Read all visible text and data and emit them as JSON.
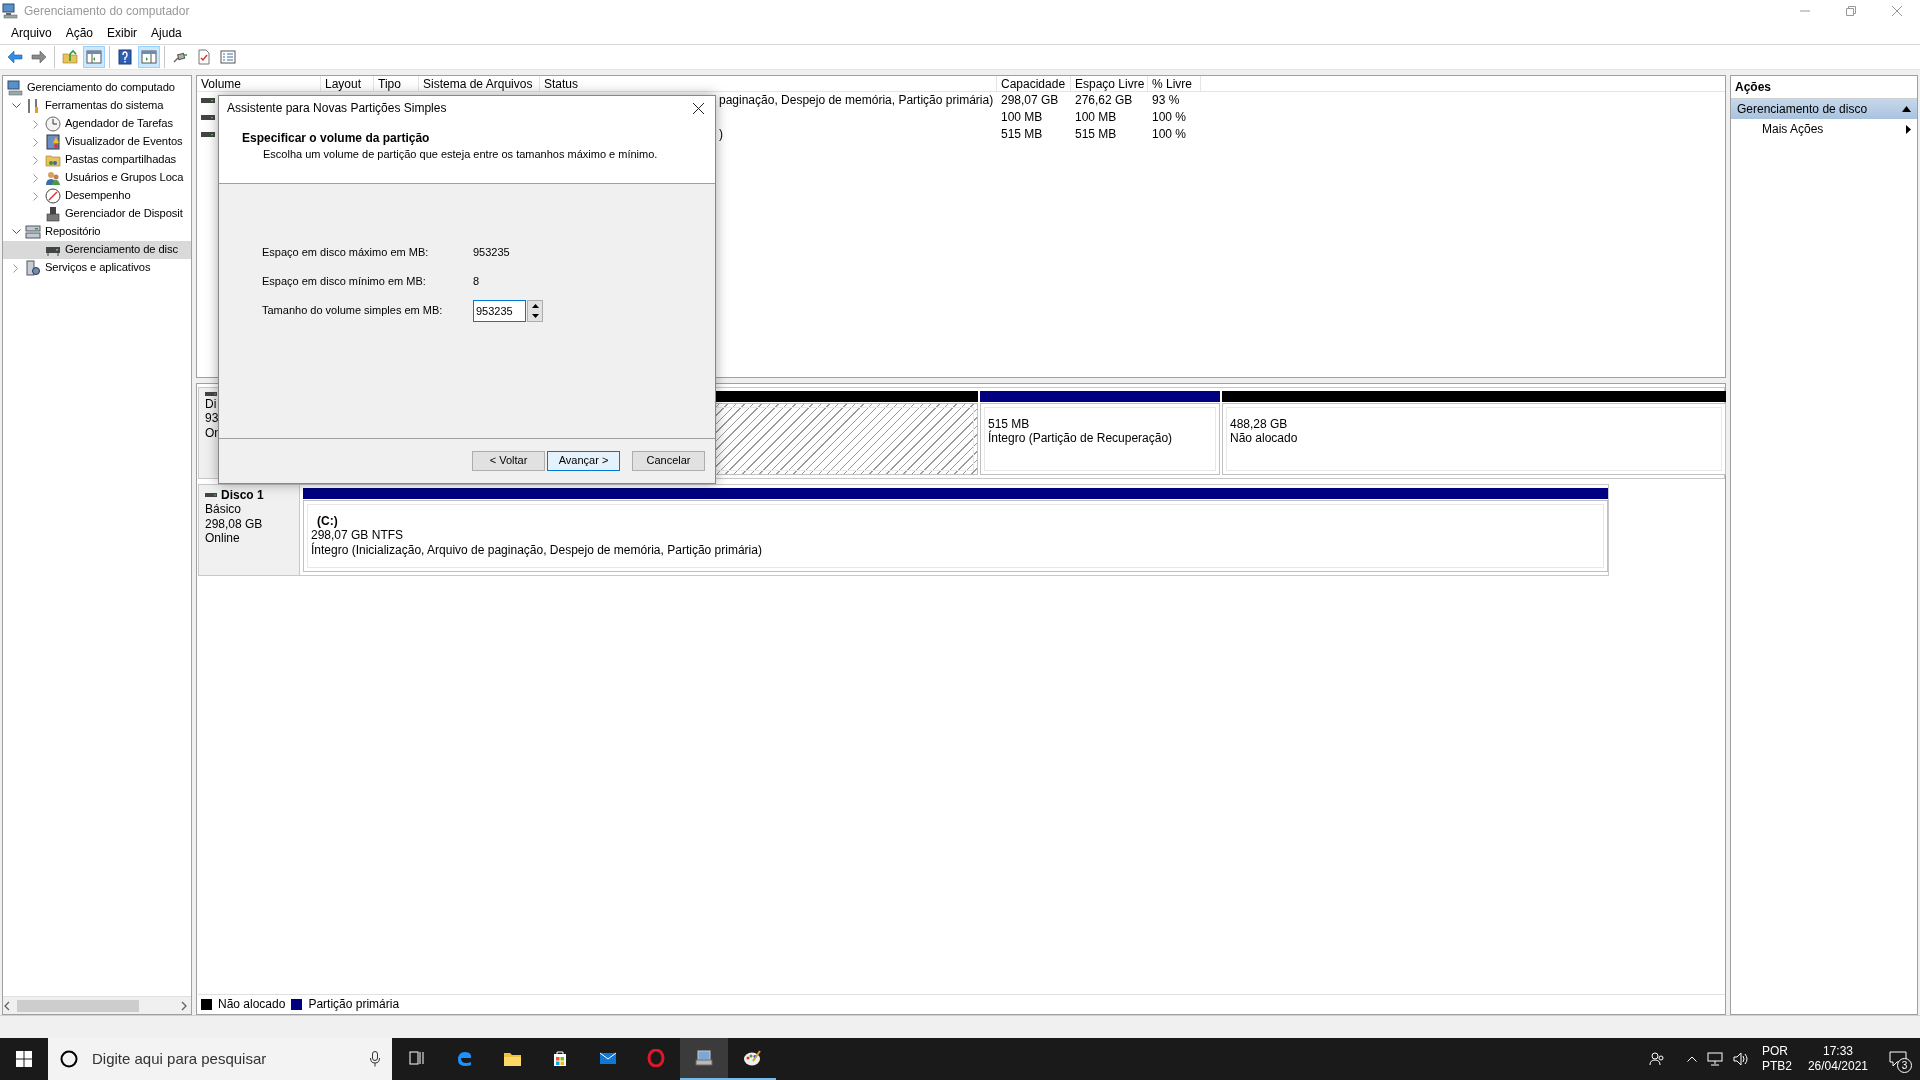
{
  "window": {
    "title": "Gerenciamento do computador"
  },
  "menu": [
    {
      "label": "Arquivo"
    },
    {
      "label": "Ação"
    },
    {
      "label": "Exibir"
    },
    {
      "label": "Ajuda"
    }
  ],
  "toolbar": [
    {
      "buttons": [
        {
          "pressed": false
        },
        {
          "pressed": false
        }
      ]
    },
    {
      "buttons": [
        {
          "pressed": false
        },
        {
          "pressed": true
        }
      ]
    },
    {
      "buttons": [
        {
          "pressed": false
        },
        {
          "pressed": true
        }
      ]
    },
    {
      "buttons": [
        {
          "pressed": false
        },
        {
          "pressed": false
        },
        {
          "pressed": false
        }
      ]
    }
  ],
  "tree": [
    {
      "label": "Gerenciamento do computado",
      "selected": false,
      "children": [
        {
          "label": "Ferramentas do sistema",
          "selected": false,
          "expanded": true,
          "children": [
            {
              "label": "Agendador de Tarefas",
              "selected": false,
              "expanded": false
            },
            {
              "label": "Visualizador de Eventos",
              "selected": false,
              "expanded": false
            },
            {
              "label": "Pastas compartilhadas",
              "selected": false,
              "expanded": false
            },
            {
              "label": "Usuários e Grupos Loca",
              "selected": false,
              "expanded": false
            },
            {
              "label": "Desempenho",
              "selected": false,
              "expanded": false
            },
            {
              "label": "Gerenciador de Disposit",
              "selected": false
            }
          ]
        },
        {
          "label": "Repositório",
          "selected": false,
          "expanded": true,
          "children": [
            {
              "label": "Gerenciamento de disc",
              "selected": true
            }
          ]
        },
        {
          "label": "Serviços e aplicativos",
          "selected": false,
          "expanded": false
        }
      ]
    }
  ],
  "table": {
    "columns": [
      "Volume",
      "Layout",
      "Tipo",
      "Sistema de Arquivos",
      "Status",
      "Capacidade",
      "Espaço Livre",
      "% Livre"
    ],
    "rows": [
      {
        "status": "paginação, Despejo de memória, Partição primária)",
        "capacity": "298,07 GB",
        "free_space": "276,62 GB",
        "percent_free": "93 %"
      },
      {
        "capacity": "100 MB",
        "free_space": "100 MB",
        "percent_free": "100 %"
      },
      {
        "status": ")",
        "capacity": "515 MB",
        "free_space": "515 MB",
        "percent_free": "100 %"
      }
    ]
  },
  "disks": [
    {
      "lines": [
        "Di",
        "93",
        "On"
      ],
      "partitions": [
        {
          "kind": "unallocated",
          "selected": true
        },
        {
          "kind": "primary",
          "selected": false,
          "lines": [
            "515 MB",
            "Íntegro (Partição de Recuperação)"
          ]
        },
        {
          "kind": "unallocated",
          "selected": false,
          "lines": [
            "488,28 GB",
            "Não alocado"
          ]
        }
      ]
    },
    {
      "name": "Disco 1",
      "lines": [
        "Básico",
        "298,08 GB",
        "Online"
      ],
      "partitions": [
        {
          "kind": "primary",
          "selected": false,
          "name": "(C:)",
          "lines": [
            "298,07 GB NTFS",
            "Íntegro (Inicialização, Arquivo de paginação, Despejo de memória, Partição primária)"
          ]
        }
      ]
    }
  ],
  "legend": [
    {
      "label": "Não alocado",
      "color": "#000000"
    },
    {
      "label": "Partição primária",
      "color": "#000080"
    }
  ],
  "actions": {
    "title": "Ações",
    "items": [
      {
        "kind": "header",
        "label": "Gerenciamento de disco",
        "expanded": true
      },
      {
        "kind": "link",
        "label": "Mais Ações"
      }
    ]
  },
  "dialog": {
    "title": "Assistente para Novas Partições Simples",
    "heading": "Especificar o volume da partição",
    "description": "Escolha um volume de partição que esteja entre os tamanhos máximo e mínimo.",
    "fields": [
      {
        "kind": "readonly",
        "label": "Espaço em disco máximo em MB:",
        "value": "953235"
      },
      {
        "kind": "readonly",
        "label": "Espaço em disco mínimo em MB:",
        "value": "8"
      },
      {
        "kind": "spinner",
        "label": "Tamanho do volume simples em MB:",
        "value": "953235",
        "focused": true
      }
    ],
    "buttons": [
      {
        "label": "< Voltar",
        "default": false
      },
      {
        "label": "Avançar >",
        "default": true
      },
      {
        "label": "Cancelar",
        "default": false
      }
    ]
  },
  "taskbar": {
    "search": {
      "placeholder": "Digite aqui para pesquisar"
    },
    "apps": [
      {
        "running": false,
        "active": false
      },
      {
        "running": false,
        "active": false
      },
      {
        "running": false,
        "active": false
      },
      {
        "running": false,
        "active": false
      },
      {
        "running": false,
        "active": false
      },
      {
        "running": false,
        "active": false
      },
      {
        "running": true,
        "active": true
      },
      {
        "running": true,
        "active": false
      }
    ],
    "language": [
      "POR",
      "PTB2"
    ],
    "time": "17:33",
    "date": "26/04/2021",
    "notifications": "3"
  }
}
